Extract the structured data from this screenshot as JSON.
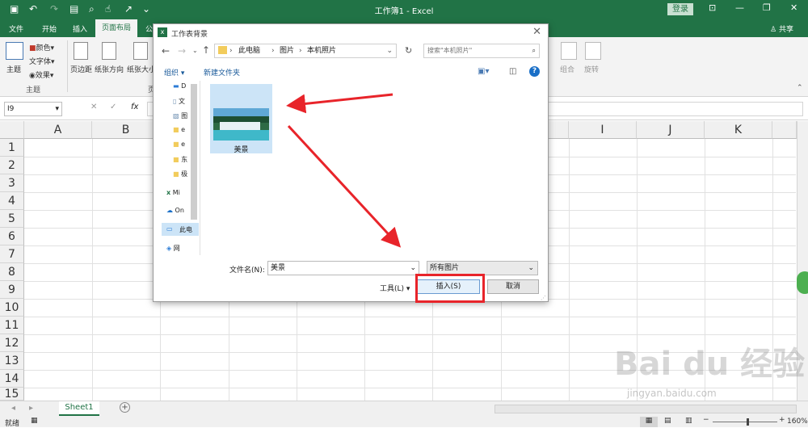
{
  "app": {
    "title": "工作簿1 - Excel",
    "login": "登录",
    "share": "共享"
  },
  "tabs": [
    {
      "label": "文件"
    },
    {
      "label": "开始"
    },
    {
      "label": "插入"
    },
    {
      "label": "页面布局"
    },
    {
      "label": "公"
    }
  ],
  "ribbon": {
    "theme_main": "主题",
    "colors": "颜色",
    "fonts": "字体",
    "effects": "效果",
    "group_theme": "主题",
    "margins": "页边距",
    "orientation": "纸张方向",
    "size": "纸张大小",
    "group_page": "页",
    "group_arrange": "组合",
    "rotate": "旋转"
  },
  "formula_bar": {
    "name_box": "I9",
    "fx": "fx"
  },
  "columns": [
    "A",
    "B",
    "I",
    "J",
    "K"
  ],
  "rows": [
    "1",
    "2",
    "3",
    "4",
    "5",
    "6",
    "7",
    "8",
    "9",
    "10",
    "11",
    "12",
    "13",
    "14",
    "15"
  ],
  "sheet": {
    "name": "Sheet1",
    "add": "+"
  },
  "status": {
    "ready": "就绪",
    "zoom": "160%"
  },
  "dialog": {
    "title": "工作表背景",
    "breadcrumb": [
      "此电脑",
      "图片",
      "本机照片"
    ],
    "search_placeholder": "搜索\"本机照片\"",
    "organize": "组织",
    "new_folder": "新建文件夹",
    "nav_items": [
      {
        "label": "D"
      },
      {
        "label": "文"
      },
      {
        "label": "图"
      },
      {
        "label": "e"
      },
      {
        "label": "e"
      },
      {
        "label": "东"
      },
      {
        "label": "极"
      },
      {
        "label": "Mi"
      },
      {
        "label": "On"
      },
      {
        "label": "此电"
      },
      {
        "label": "网"
      }
    ],
    "file_label": "美景",
    "filename_label": "文件名(N):",
    "filename_value": "美景",
    "filetype": "所有图片",
    "tools": "工具(L)",
    "insert": "插入(S)",
    "cancel": "取消"
  },
  "watermark": {
    "brand": "Bai du 经验",
    "url": "jingyan.baidu.com"
  },
  "colors": {
    "excel_green": "#217346",
    "highlight_red": "#e8242a"
  }
}
